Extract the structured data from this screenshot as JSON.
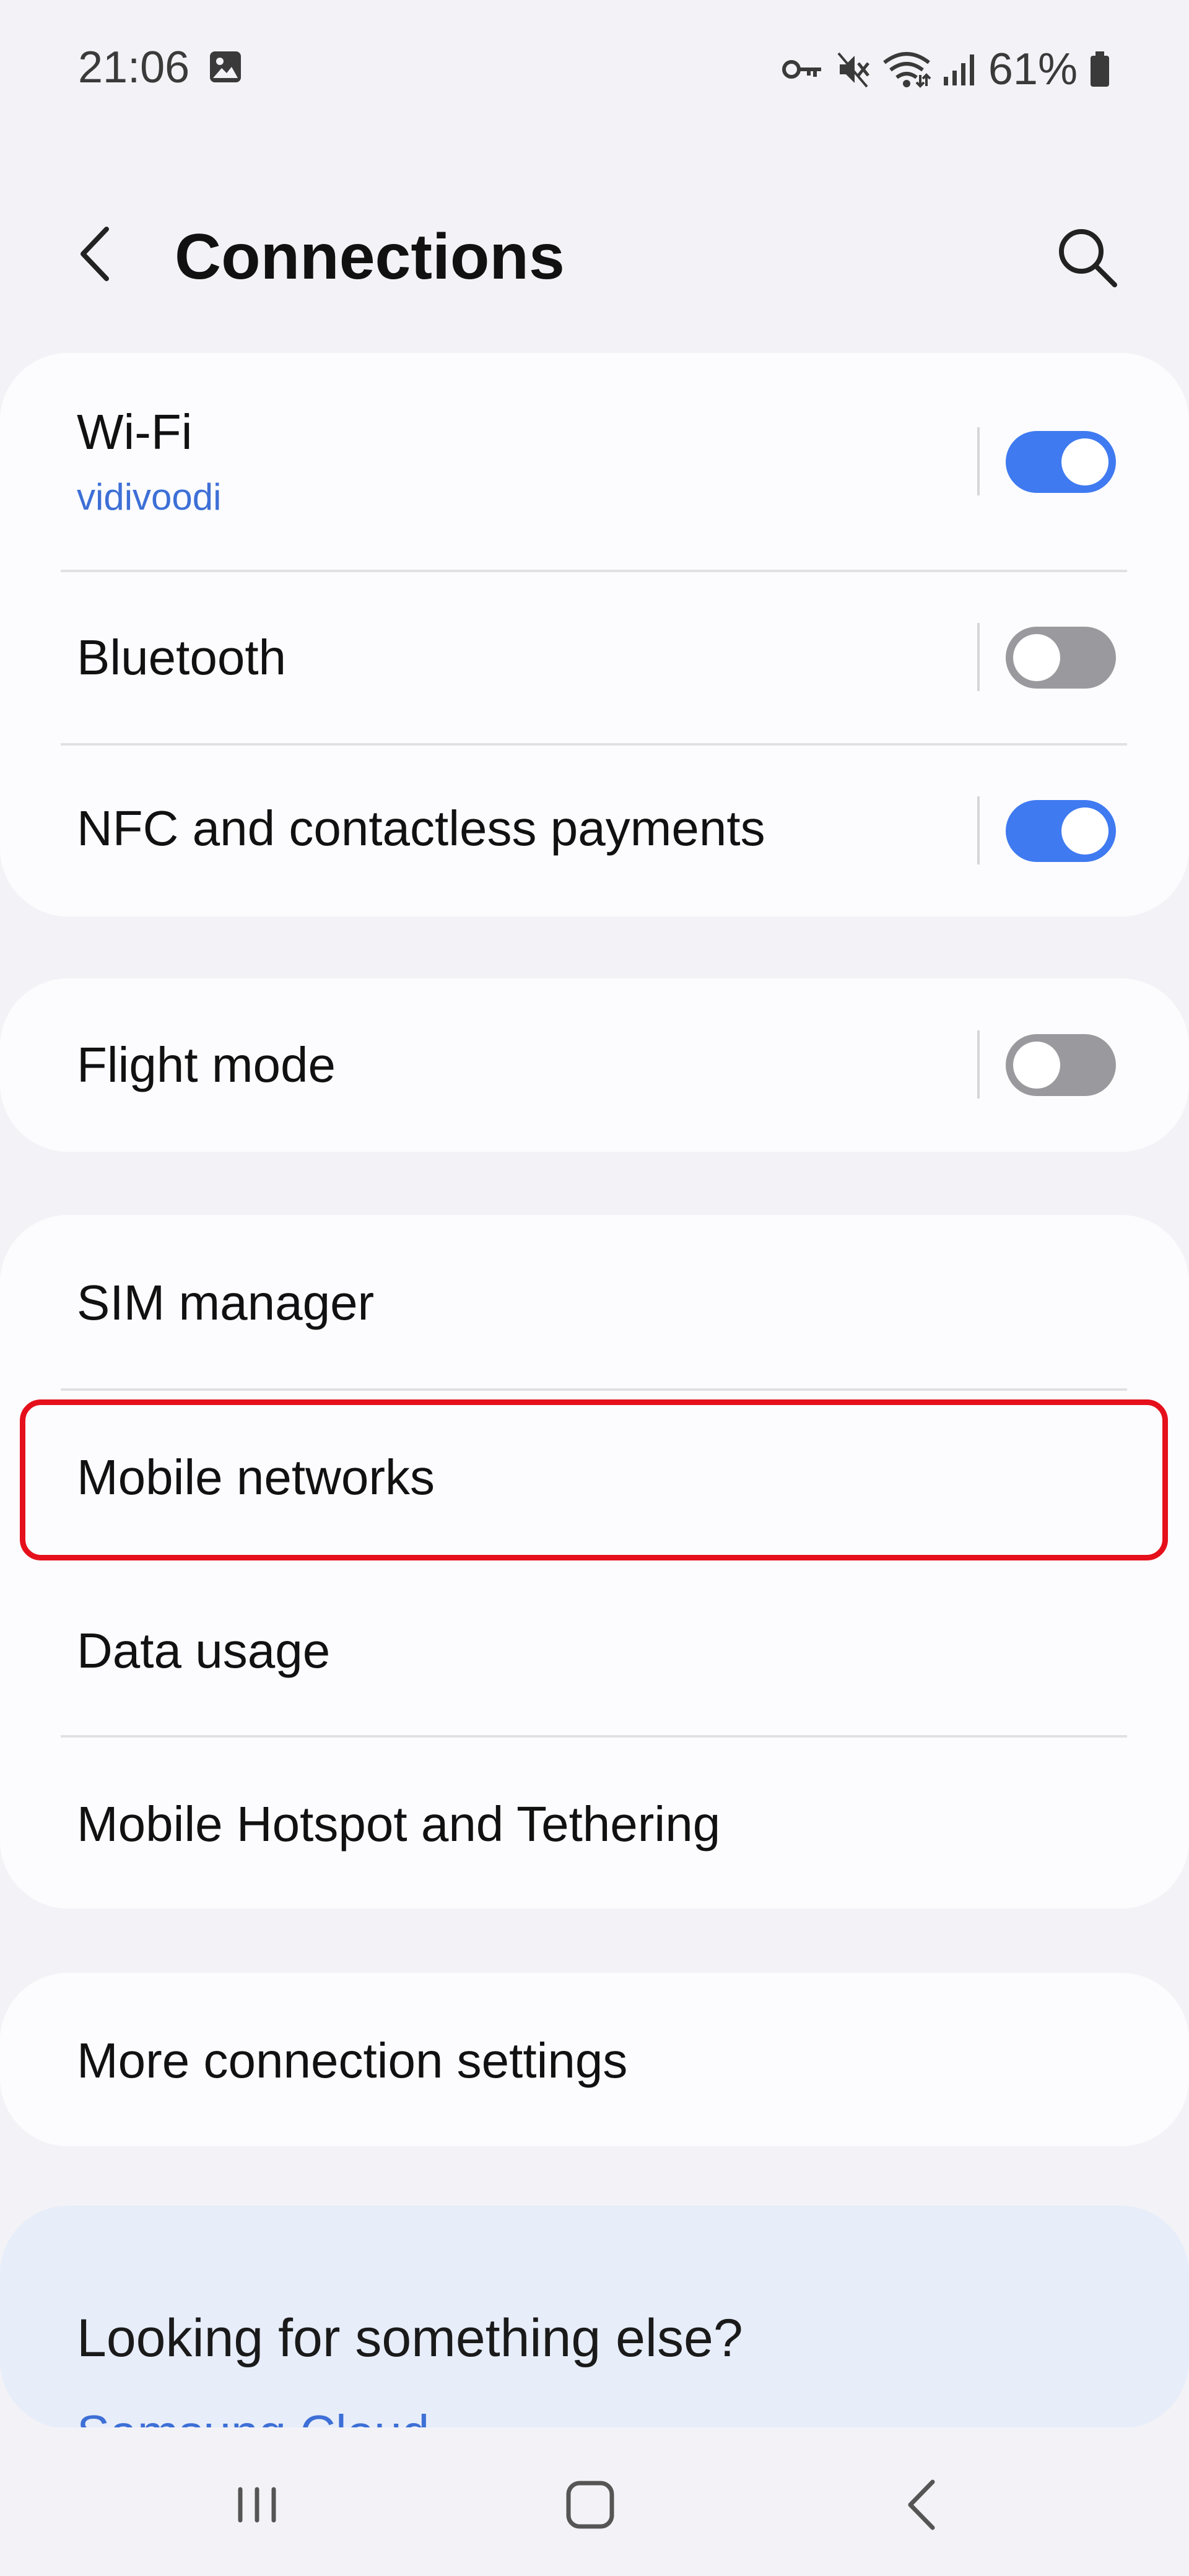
{
  "status_bar": {
    "time": "21:06",
    "battery_percent": "61%",
    "icons": [
      "gallery-icon",
      "vpn-key-icon",
      "mute-icon",
      "wifi-icon",
      "signal-icon",
      "battery-icon"
    ]
  },
  "header": {
    "title": "Connections",
    "back_icon": "chevron-left-icon",
    "search_icon": "search-icon"
  },
  "groups": [
    {
      "items": [
        {
          "label": "Wi-Fi",
          "subtitle": "vidivoodi",
          "toggle": true
        },
        {
          "label": "Bluetooth",
          "toggle": false
        },
        {
          "label": "NFC and contactless payments",
          "toggle": true
        }
      ]
    },
    {
      "items": [
        {
          "label": "Flight mode",
          "toggle": false
        }
      ]
    },
    {
      "items": [
        {
          "label": "SIM manager"
        },
        {
          "label": "Mobile networks",
          "highlighted": true
        },
        {
          "label": "Data usage"
        },
        {
          "label": "Mobile Hotspot and Tethering"
        }
      ]
    },
    {
      "items": [
        {
          "label": "More connection settings"
        }
      ]
    }
  ],
  "suggestions": {
    "title": "Looking for something else?",
    "link": "Samsung Cloud"
  },
  "colors": {
    "accent": "#3f7af1",
    "link": "#3d6fd6",
    "highlight": "#e5101b",
    "background": "#f3f3f7",
    "card": "#fcfcfe",
    "suggest_card": "#e7edf9"
  },
  "nav_bar": {
    "icons": [
      "recent-apps-icon",
      "home-icon",
      "back-icon"
    ]
  }
}
